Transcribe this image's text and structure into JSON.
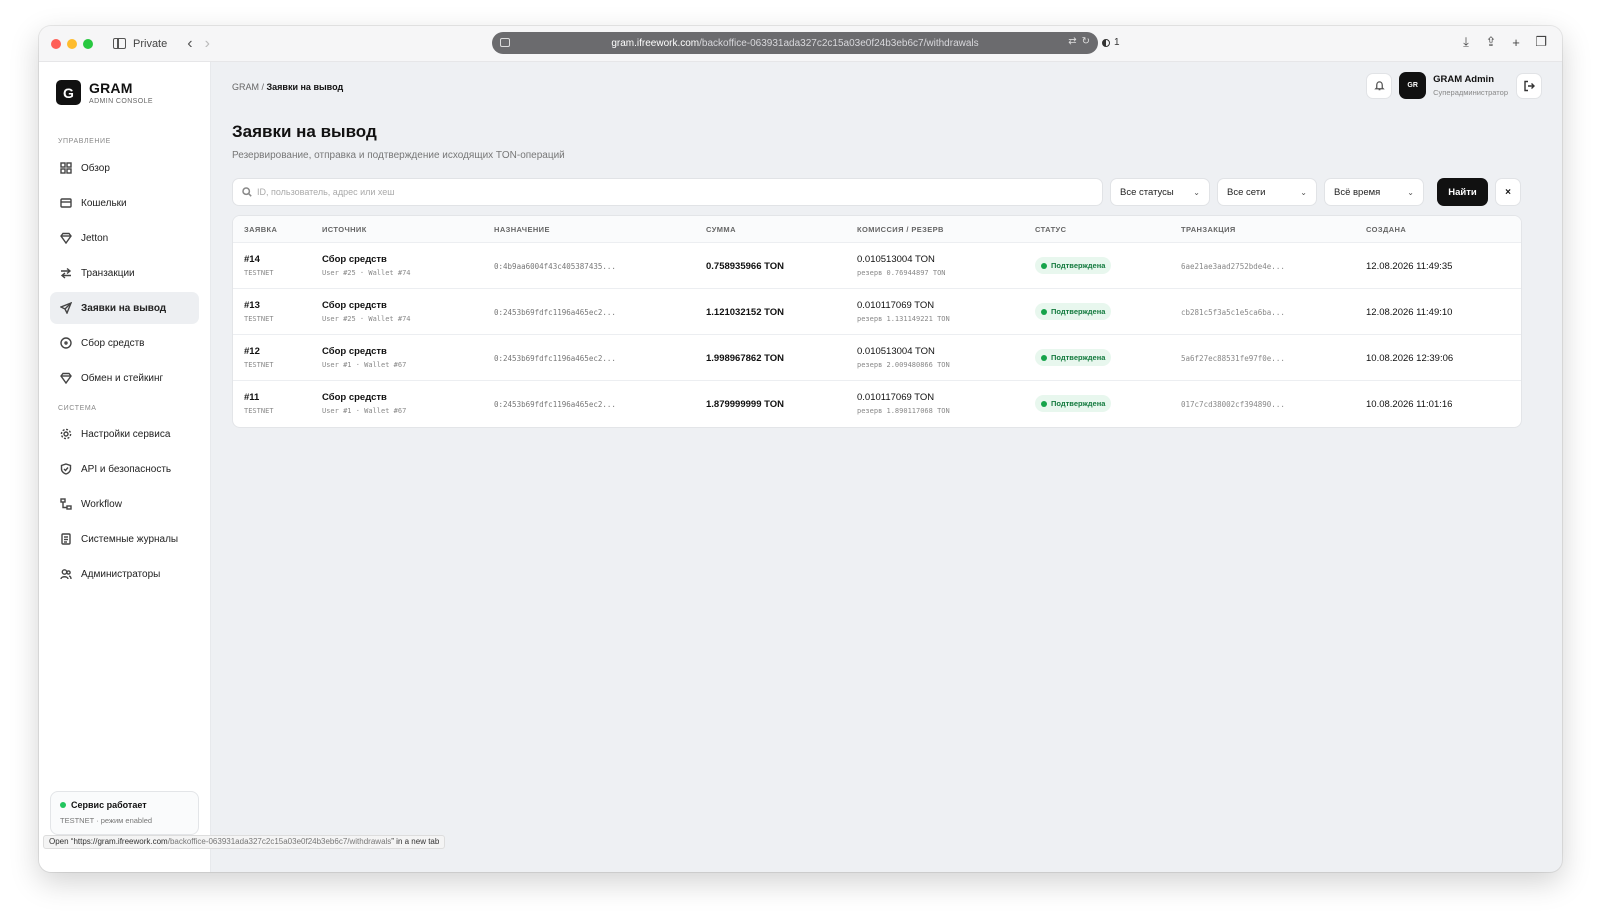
{
  "browser": {
    "private_label": "Private",
    "url_host": "gram.ifreework.com",
    "url_path": "/backoffice-063931ada327c2c15a03e0f24b3eb6c7/withdrawals",
    "extension_count": "1",
    "status_prefix": "Open “https://gram.ifreework.com",
    "status_path": "/backoffice-063931ada327c2c15a03e0f24b3eb6c7/withdrawals",
    "status_suffix": "” in a new tab"
  },
  "brand": {
    "letter": "G",
    "title": "GRAM",
    "subtitle": "ADMIN CONSOLE"
  },
  "sidebar": {
    "section_manage": "УПРАВЛЕНИЕ",
    "section_system": "СИСТЕМА",
    "items": [
      {
        "label": "Обзор",
        "icon": "grid-icon"
      },
      {
        "label": "Кошельки",
        "icon": "wallet-icon"
      },
      {
        "label": "Jetton",
        "icon": "diamond-icon"
      },
      {
        "label": "Транзакции",
        "icon": "arrows-icon"
      },
      {
        "label": "Заявки на вывод",
        "icon": "send-icon"
      },
      {
        "label": "Сбор средств",
        "icon": "circle-icon"
      },
      {
        "label": "Обмен и стейкинг",
        "icon": "diamond-icon"
      },
      {
        "label": "Настройки сервиса",
        "icon": "gear-icon"
      },
      {
        "label": "API и безопасность",
        "icon": "shield-icon"
      },
      {
        "label": "Workflow",
        "icon": "workflow-icon"
      },
      {
        "label": "Системные журналы",
        "icon": "document-icon"
      },
      {
        "label": "Администраторы",
        "icon": "users-icon"
      }
    ],
    "service": {
      "status": "Сервис работает",
      "sub": "TESTNET · режим enabled",
      "status_color": "#22c55e"
    }
  },
  "header": {
    "breadcrumb_root": "GRAM /",
    "breadcrumb_current": "Заявки на вывод",
    "user_initials": "GR",
    "user_name": "GRAM Admin",
    "user_role": "Суперадминистратор"
  },
  "page": {
    "title": "Заявки на вывод",
    "subtitle": "Резервирование, отправка и подтверждение исходящих TON-операций"
  },
  "filters": {
    "search_placeholder": "ID, пользователь, адрес или хеш",
    "status": "Все статусы",
    "network": "Все сети",
    "period": "Всё время",
    "find_label": "Найти",
    "clear_label": "×"
  },
  "table": {
    "headers": [
      "ЗАЯВКА",
      "ИСТОЧНИК",
      "НАЗНАЧЕНИЕ",
      "СУММА",
      "КОМИССИЯ / РЕЗЕРВ",
      "СТАТУС",
      "ТРАНЗАКЦИЯ",
      "СОЗДАНА"
    ],
    "rows": [
      {
        "id": "#14",
        "network": "TESTNET",
        "source": "Сбор средств",
        "source_sub": "User #25 · Wallet #74",
        "destination": "0:4b9aa6004f43c405387435...",
        "amount": "0.758935966 TON",
        "fee": "0.010513004 TON",
        "reserve": "резерв 0.76944897 TON",
        "status": "Подтверждена",
        "tx": "6ae21ae3aad2752bde4e...",
        "created": "12.08.2026 11:49:35"
      },
      {
        "id": "#13",
        "network": "TESTNET",
        "source": "Сбор средств",
        "source_sub": "User #25 · Wallet #74",
        "destination": "0:2453b69fdfc1196a465ec2...",
        "amount": "1.121032152 TON",
        "fee": "0.010117069 TON",
        "reserve": "резерв 1.131149221 TON",
        "status": "Подтверждена",
        "tx": "cb281c5f3a5c1e5ca6ba...",
        "created": "12.08.2026 11:49:10"
      },
      {
        "id": "#12",
        "network": "TESTNET",
        "source": "Сбор средств",
        "source_sub": "User #1 · Wallet #67",
        "destination": "0:2453b69fdfc1196a465ec2...",
        "amount": "1.998967862 TON",
        "fee": "0.010513004 TON",
        "reserve": "резерв 2.009480866 TON",
        "status": "Подтверждена",
        "tx": "5a6f27ec88531fe97f0e...",
        "created": "10.08.2026 12:39:06"
      },
      {
        "id": "#11",
        "network": "TESTNET",
        "source": "Сбор средств",
        "source_sub": "User #1 · Wallet #67",
        "destination": "0:2453b69fdfc1196a465ec2...",
        "amount": "1.879999999 TON",
        "fee": "0.010117069 TON",
        "reserve": "резерв 1.890117068 TON",
        "status": "Подтверждена",
        "tx": "017c7cd38002cf394890...",
        "created": "10.08.2026 11:01:16"
      }
    ]
  },
  "colors": {
    "status_confirmed": "#16a34a",
    "accent": "#111111"
  }
}
